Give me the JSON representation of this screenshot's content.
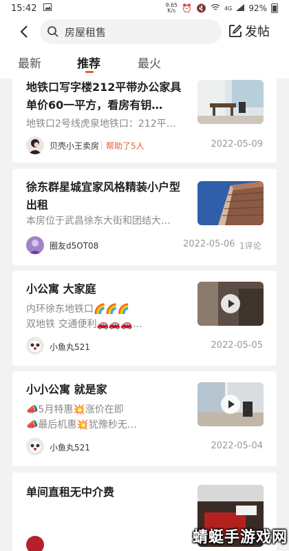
{
  "status_bar": {
    "time": "15:42",
    "speed_value": "9.65",
    "speed_unit": "K/s",
    "network": "4G",
    "battery": "92%"
  },
  "header": {
    "search_text": "房屋租售",
    "post_label": "发帖"
  },
  "tabs": [
    {
      "label": "最新"
    },
    {
      "label": "推荐",
      "active": true
    },
    {
      "label": "最火"
    }
  ],
  "posts": [
    {
      "title": "地铁口写字楼212平带办公家具单价60一平方，看房有钥…",
      "desc": "地铁口2号线虎泉地铁口：212平…",
      "author": "贝壳小王卖房",
      "helped": "帮助了5人",
      "date": "2022-05-09"
    },
    {
      "title": "徐东群星城宜家风格精装小户型出租",
      "desc": "本房位于武昌徐东大街和团结大…",
      "author": "圈友d5OT08",
      "date": "2022-05-06",
      "comments": "1评论"
    },
    {
      "title": "小公寓 大家庭",
      "desc_line1": "内环徐东地铁口🌈🌈🌈",
      "desc_line2": "双地铁 交通便利🚗🚗🚗…",
      "author": "小鱼丸521",
      "date": "2022-05-05"
    },
    {
      "title": "小小公寓 就是家",
      "desc_line1": "📣5月特惠💥涨价在即",
      "desc_line2": "📣最后机惠💥犹豫秒无…",
      "author": "小鱼丸521",
      "date": "2022-05-04"
    },
    {
      "title": "单间直租无中介费"
    }
  ],
  "watermark": "蜻蜓手游戏网"
}
